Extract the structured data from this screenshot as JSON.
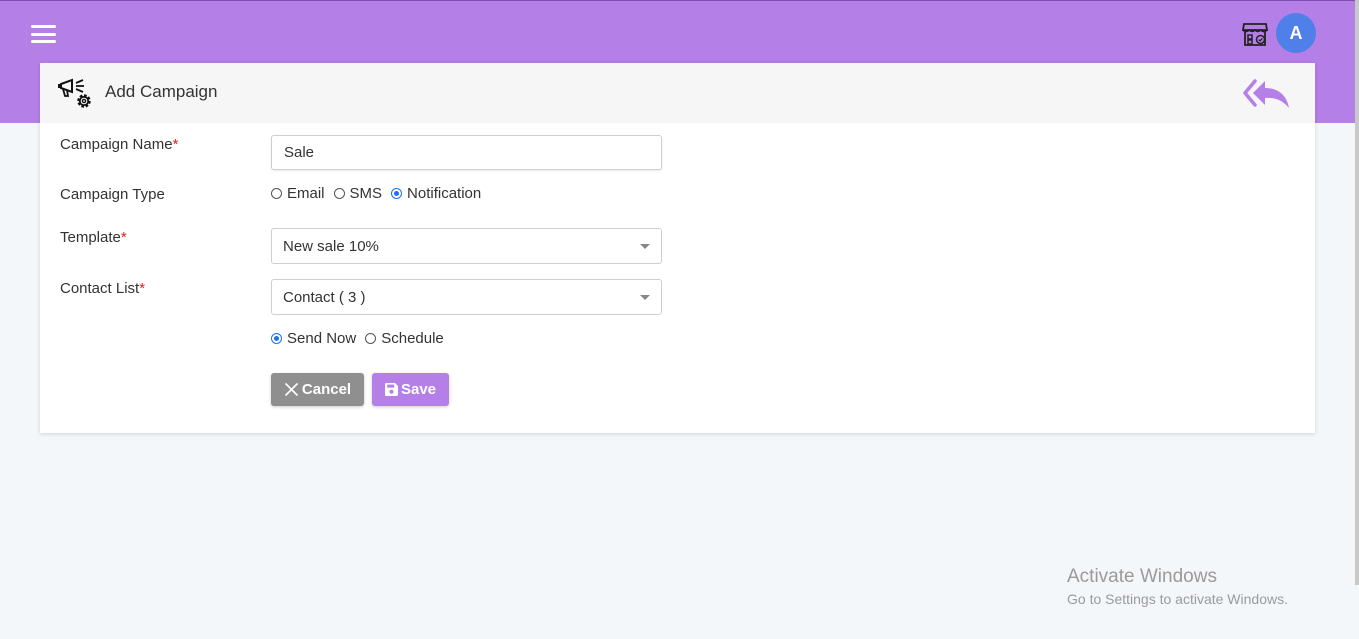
{
  "form": {
    "title": "Add Campaign",
    "campaign_name_label": "Campaign Name",
    "campaign_name_value": "Sale",
    "required_mark": "*",
    "campaign_type_label": "Campaign Type",
    "campaign_type_options": [
      "Email",
      "SMS",
      "Notification"
    ],
    "campaign_type_selected": "Notification",
    "template_label": "Template",
    "template_value": "New sale 10%",
    "contact_list_label": "Contact List",
    "contact_list_value": "Contact ( 3 )",
    "send_options": [
      "Send Now",
      "Schedule"
    ],
    "send_selected": "Send Now",
    "cancel_label": "Cancel",
    "save_label": "Save"
  },
  "header": {
    "avatar_letter": "A"
  },
  "watermark": {
    "title": "Activate Windows",
    "subtitle": "Go to Settings to activate Windows."
  },
  "colors": {
    "accent": "#b57fe8",
    "avatar": "#4f7fe8",
    "cancel": "#8f8f8f",
    "radio": "#1a73e8"
  },
  "icons": {
    "menu": "hamburger-icon",
    "store": "store-icon",
    "campaign": "megaphone-gear-icon",
    "back": "double-reply-icon",
    "cancel": "close-icon",
    "save": "floppy-disk-icon"
  }
}
